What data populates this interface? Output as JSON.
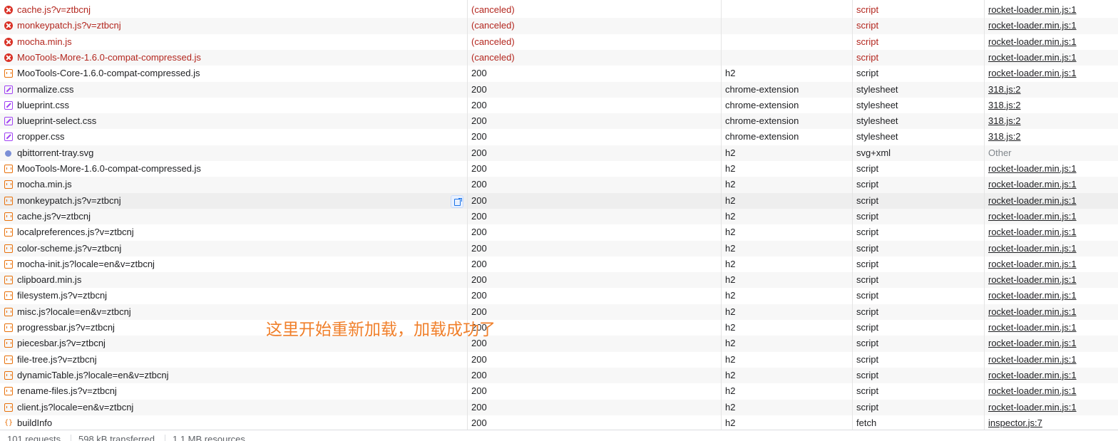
{
  "requests": [
    {
      "name": "cache.js?v=ztbcnj",
      "status": "(canceled)",
      "protocol": "",
      "type": "script",
      "initiator": "rocket-loader.min.js:1",
      "icon": "error-icon",
      "error": true,
      "initiator_link": true
    },
    {
      "name": "monkeypatch.js?v=ztbcnj",
      "status": "(canceled)",
      "protocol": "",
      "type": "script",
      "initiator": "rocket-loader.min.js:1",
      "icon": "error-icon",
      "error": true,
      "initiator_link": true
    },
    {
      "name": "mocha.min.js",
      "status": "(canceled)",
      "protocol": "",
      "type": "script",
      "initiator": "rocket-loader.min.js:1",
      "icon": "error-icon",
      "error": true,
      "initiator_link": true
    },
    {
      "name": "MooTools-More-1.6.0-compat-compressed.js",
      "status": "(canceled)",
      "protocol": "",
      "type": "script",
      "initiator": "rocket-loader.min.js:1",
      "icon": "error-icon",
      "error": true,
      "initiator_link": true
    },
    {
      "name": "MooTools-Core-1.6.0-compat-compressed.js",
      "status": "200",
      "protocol": "h2",
      "type": "script",
      "initiator": "rocket-loader.min.js:1",
      "icon": "script-icon",
      "error": false,
      "initiator_link": true
    },
    {
      "name": "normalize.css",
      "status": "200",
      "protocol": "chrome-extension",
      "type": "stylesheet",
      "initiator": "318.js:2",
      "icon": "stylesheet-icon",
      "error": false,
      "initiator_link": true
    },
    {
      "name": "blueprint.css",
      "status": "200",
      "protocol": "chrome-extension",
      "type": "stylesheet",
      "initiator": "318.js:2",
      "icon": "stylesheet-icon",
      "error": false,
      "initiator_link": true
    },
    {
      "name": "blueprint-select.css",
      "status": "200",
      "protocol": "chrome-extension",
      "type": "stylesheet",
      "initiator": "318.js:2",
      "icon": "stylesheet-icon",
      "error": false,
      "initiator_link": true
    },
    {
      "name": "cropper.css",
      "status": "200",
      "protocol": "chrome-extension",
      "type": "stylesheet",
      "initiator": "318.js:2",
      "icon": "stylesheet-icon",
      "error": false,
      "initiator_link": true
    },
    {
      "name": "qbittorrent-tray.svg",
      "status": "200",
      "protocol": "h2",
      "type": "svg+xml",
      "initiator": "Other",
      "icon": "image-icon",
      "error": false,
      "initiator_link": false
    },
    {
      "name": "MooTools-More-1.6.0-compat-compressed.js",
      "status": "200",
      "protocol": "h2",
      "type": "script",
      "initiator": "rocket-loader.min.js:1",
      "icon": "script-icon",
      "error": false,
      "initiator_link": true
    },
    {
      "name": "mocha.min.js",
      "status": "200",
      "protocol": "h2",
      "type": "script",
      "initiator": "rocket-loader.min.js:1",
      "icon": "script-icon",
      "error": false,
      "initiator_link": true
    },
    {
      "name": "monkeypatch.js?v=ztbcnj",
      "status": "200",
      "protocol": "h2",
      "type": "script",
      "initiator": "rocket-loader.min.js:1",
      "icon": "script-icon",
      "error": false,
      "initiator_link": true,
      "hover": true
    },
    {
      "name": "cache.js?v=ztbcnj",
      "status": "200",
      "protocol": "h2",
      "type": "script",
      "initiator": "rocket-loader.min.js:1",
      "icon": "script-icon",
      "error": false,
      "initiator_link": true
    },
    {
      "name": "localpreferences.js?v=ztbcnj",
      "status": "200",
      "protocol": "h2",
      "type": "script",
      "initiator": "rocket-loader.min.js:1",
      "icon": "script-icon",
      "error": false,
      "initiator_link": true
    },
    {
      "name": "color-scheme.js?v=ztbcnj",
      "status": "200",
      "protocol": "h2",
      "type": "script",
      "initiator": "rocket-loader.min.js:1",
      "icon": "script-icon",
      "error": false,
      "initiator_link": true
    },
    {
      "name": "mocha-init.js?locale=en&v=ztbcnj",
      "status": "200",
      "protocol": "h2",
      "type": "script",
      "initiator": "rocket-loader.min.js:1",
      "icon": "script-icon",
      "error": false,
      "initiator_link": true
    },
    {
      "name": "clipboard.min.js",
      "status": "200",
      "protocol": "h2",
      "type": "script",
      "initiator": "rocket-loader.min.js:1",
      "icon": "script-icon",
      "error": false,
      "initiator_link": true
    },
    {
      "name": "filesystem.js?v=ztbcnj",
      "status": "200",
      "protocol": "h2",
      "type": "script",
      "initiator": "rocket-loader.min.js:1",
      "icon": "script-icon",
      "error": false,
      "initiator_link": true
    },
    {
      "name": "misc.js?locale=en&v=ztbcnj",
      "status": "200",
      "protocol": "h2",
      "type": "script",
      "initiator": "rocket-loader.min.js:1",
      "icon": "script-icon",
      "error": false,
      "initiator_link": true
    },
    {
      "name": "progressbar.js?v=ztbcnj",
      "status": "200",
      "protocol": "h2",
      "type": "script",
      "initiator": "rocket-loader.min.js:1",
      "icon": "script-icon",
      "error": false,
      "initiator_link": true
    },
    {
      "name": "piecesbar.js?v=ztbcnj",
      "status": "200",
      "protocol": "h2",
      "type": "script",
      "initiator": "rocket-loader.min.js:1",
      "icon": "script-icon",
      "error": false,
      "initiator_link": true
    },
    {
      "name": "file-tree.js?v=ztbcnj",
      "status": "200",
      "protocol": "h2",
      "type": "script",
      "initiator": "rocket-loader.min.js:1",
      "icon": "script-icon",
      "error": false,
      "initiator_link": true
    },
    {
      "name": "dynamicTable.js?locale=en&v=ztbcnj",
      "status": "200",
      "protocol": "h2",
      "type": "script",
      "initiator": "rocket-loader.min.js:1",
      "icon": "script-icon",
      "error": false,
      "initiator_link": true
    },
    {
      "name": "rename-files.js?v=ztbcnj",
      "status": "200",
      "protocol": "h2",
      "type": "script",
      "initiator": "rocket-loader.min.js:1",
      "icon": "script-icon",
      "error": false,
      "initiator_link": true
    },
    {
      "name": "client.js?locale=en&v=ztbcnj",
      "status": "200",
      "protocol": "h2",
      "type": "script",
      "initiator": "rocket-loader.min.js:1",
      "icon": "script-icon",
      "error": false,
      "initiator_link": true
    },
    {
      "name": "buildInfo",
      "status": "200",
      "protocol": "h2",
      "type": "fetch",
      "initiator": "inspector.js:7",
      "icon": "fetch-icon",
      "error": false,
      "initiator_link": true
    }
  ],
  "annotation": "这里开始重新加载，加载成功了",
  "status_bar": {
    "requests": "101 requests",
    "transferred": "598 kB transferred",
    "resources": "1.1 MB resources"
  },
  "colors": {
    "error_text": "#b3261e",
    "annotation": "#f07f2a",
    "script_icon": "#e8710a",
    "stylesheet_icon": "#a142f4"
  }
}
